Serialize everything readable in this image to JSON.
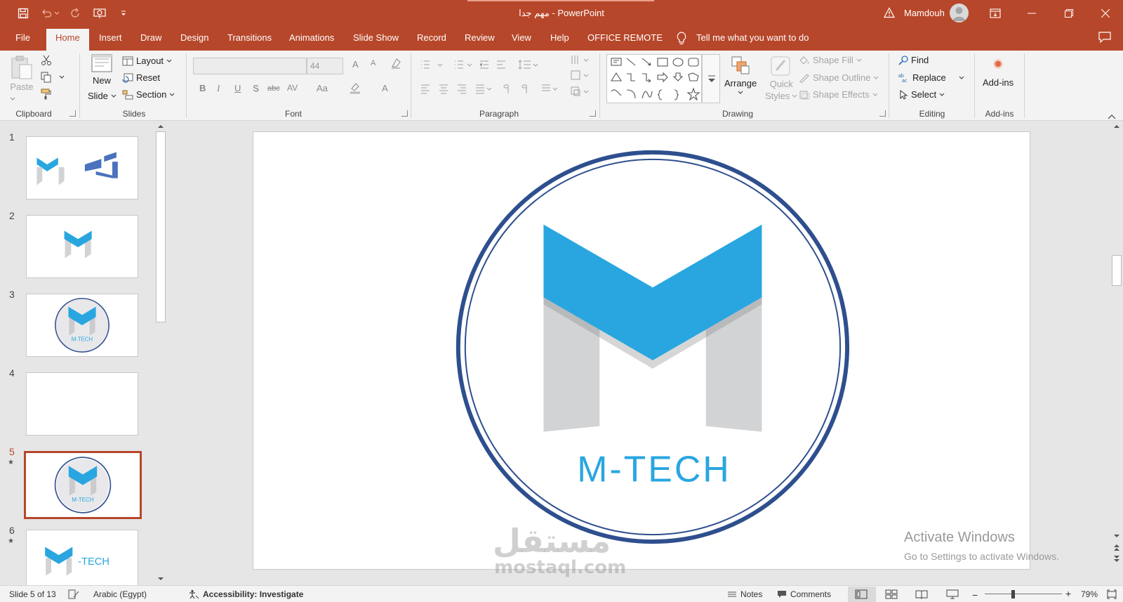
{
  "titlebar": {
    "title": "مهم جدا  -  PowerPoint",
    "user": "Mamdouh",
    "bg": "#b7472a"
  },
  "tabs": [
    "File",
    "Home",
    "Insert",
    "Draw",
    "Design",
    "Transitions",
    "Animations",
    "Slide Show",
    "Record",
    "Review",
    "View",
    "Help",
    "OFFICE REMOTE"
  ],
  "active_tab": "Home",
  "tell_me": "Tell me what you want to do",
  "ribbon": {
    "clipboard": {
      "paste": "Paste",
      "label": "Clipboard"
    },
    "slides": {
      "new_slide": "New",
      "new_slide2": "Slide",
      "layout": "Layout",
      "reset": "Reset",
      "section": "Section",
      "label": "Slides"
    },
    "font": {
      "font_size": "44",
      "label": "Font",
      "bold": "B",
      "italic": "I",
      "underline": "U",
      "shadow": "S",
      "strike": "abc",
      "spacing": "AV",
      "case": "Aa",
      "grow": "A",
      "shrink": "A",
      "color": "A"
    },
    "paragraph": {
      "label": "Paragraph"
    },
    "drawing": {
      "arrange": "Arrange",
      "quick_styles": "Quick",
      "quick_styles2": "Styles",
      "shape_fill": "Shape Fill",
      "shape_outline": "Shape Outline",
      "shape_effects": "Shape Effects",
      "label": "Drawing"
    },
    "editing": {
      "find": "Find",
      "replace": "Replace",
      "select": "Select",
      "label": "Editing"
    },
    "addins": {
      "addins": "Add-ins",
      "label": "Add-ins"
    }
  },
  "slides": [
    {
      "num": "1",
      "star": false
    },
    {
      "num": "2",
      "star": false
    },
    {
      "num": "3",
      "star": false
    },
    {
      "num": "4",
      "star": false
    },
    {
      "num": "5",
      "star": true
    },
    {
      "num": "6",
      "star": true
    }
  ],
  "selected_slide": "5",
  "thumb_logo_text": "M-TECH",
  "thumb6_text": "-TECH",
  "slide": {
    "logo_text": "M-TECH",
    "colors": {
      "ring": "#2e4f8e",
      "m_blue": "#29a6e0",
      "m_gray": "#d2d3d5",
      "text": "#29a6e0"
    }
  },
  "activate": {
    "line1": "Activate Windows",
    "line2": "Go to Settings to activate Windows."
  },
  "watermark": {
    "arabic": "مستقل",
    "latin": "mostaql.com"
  },
  "status": {
    "slide_of": "Slide 5 of 13",
    "language": "Arabic (Egypt)",
    "accessibility": "Accessibility: Investigate",
    "notes": "Notes",
    "comments": "Comments",
    "zoom": "79%",
    "zoom_minus": "−",
    "zoom_plus": "+"
  }
}
